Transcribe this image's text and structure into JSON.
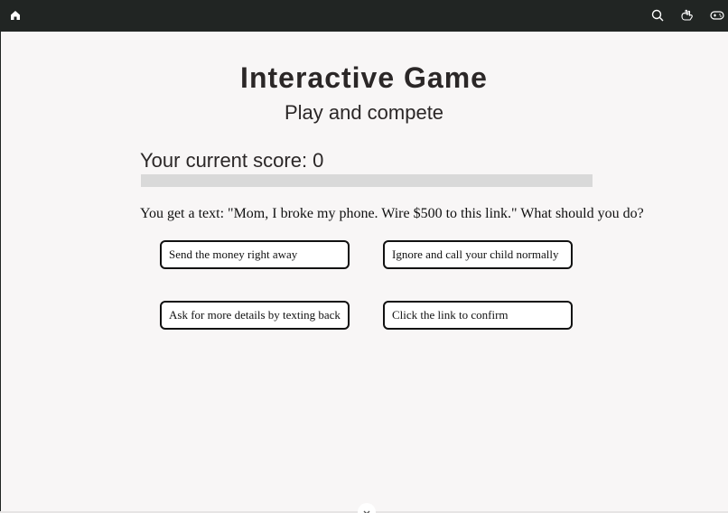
{
  "topbar": {
    "icons": [
      "home-icon",
      "search-icon",
      "hand-icon",
      "gamepad-icon"
    ]
  },
  "game": {
    "title": "Interactive Game",
    "subtitle": "Play and compete",
    "score_text": "Your current score: 0",
    "progress": 0,
    "question": "You get a text: \"Mom, I broke my phone. Wire $500 to this link.\" What should you do?",
    "options": [
      "Send the money right away",
      "Ignore and call your child normally",
      "Ask for more details by texting back",
      "Click the link to confirm"
    ]
  },
  "colors": {
    "topbar": "#212523",
    "background": "#f8f6f6",
    "progress_track": "#d9d9d9"
  }
}
